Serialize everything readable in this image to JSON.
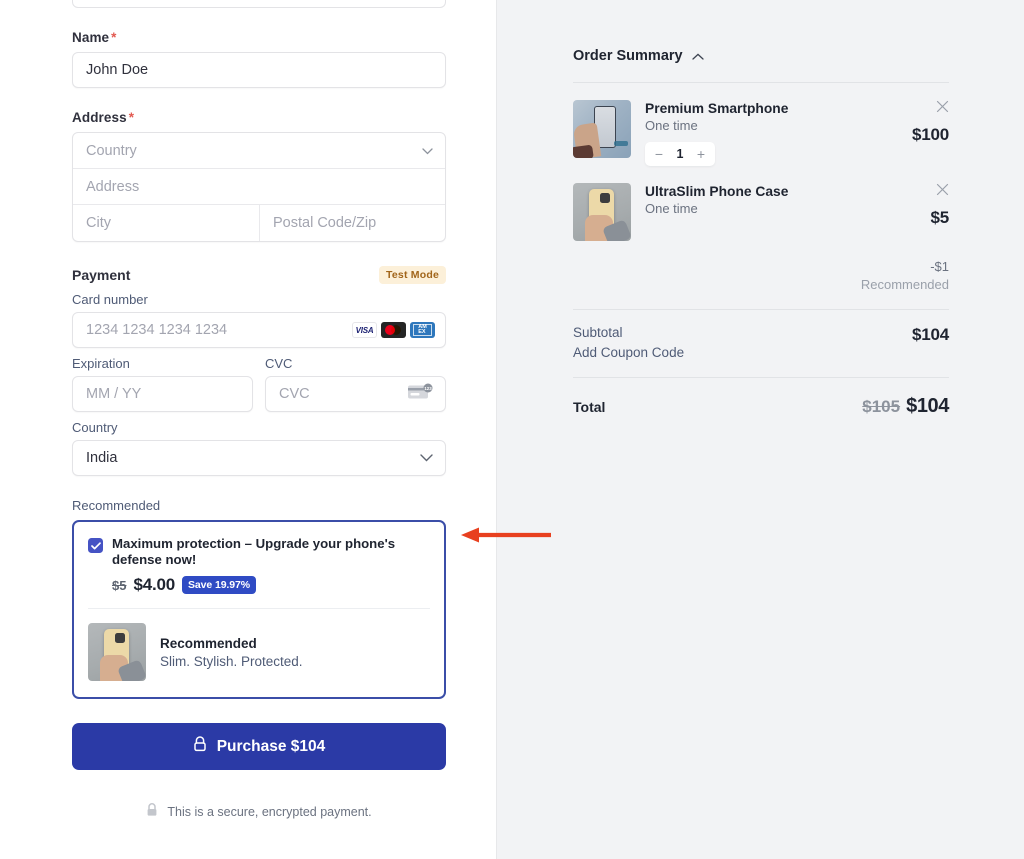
{
  "form": {
    "name": {
      "label": "Name",
      "required_marker": "*",
      "value": "John Doe"
    },
    "address": {
      "label": "Address",
      "required_marker": "*",
      "country_placeholder": "Country",
      "address_placeholder": "Address",
      "city_placeholder": "City",
      "postal_placeholder": "Postal Code/Zip"
    },
    "payment": {
      "title": "Payment",
      "test_mode_badge": "Test Mode",
      "card_number_label": "Card number",
      "card_number_placeholder": "1234 1234 1234 1234",
      "expiration_label": "Expiration",
      "expiration_placeholder": "MM / YY",
      "cvc_label": "CVC",
      "cvc_placeholder": "CVC",
      "country_label": "Country",
      "country_value": "India",
      "brands": [
        "visa-icon",
        "mastercard-icon",
        "amex-icon"
      ]
    },
    "recommended": {
      "section_label": "Recommended",
      "checked": true,
      "headline": "Maximum protection – Upgrade your phone's defense now!",
      "old_price": "$5",
      "new_price": "$4.00",
      "save_badge": "Save 19.97%",
      "item_title": "Recommended",
      "item_desc": "Slim. Stylish. Protected.",
      "thumb_icon": "phone-case-thumbnail"
    },
    "purchase": {
      "lock_icon": "lock-icon",
      "label": "Purchase $104",
      "secure_note": "This is a secure, encrypted payment.",
      "secure_note_icon": "lock-icon"
    }
  },
  "summary": {
    "title": "Order Summary",
    "collapse_icon": "chevron-up-icon",
    "items": [
      {
        "name": "Premium Smartphone",
        "frequency": "One time",
        "price": "$100",
        "quantity": "1",
        "minus_label": "−",
        "plus_label": "+",
        "remove_icon": "close-icon",
        "thumb_icon": "smartphone-in-hand-thumbnail",
        "has_quantity": true
      },
      {
        "name": "UltraSlim Phone Case",
        "frequency": "One time",
        "price": "$5",
        "remove_icon": "close-icon",
        "thumb_icon": "phone-case-thumbnail",
        "has_quantity": false
      }
    ],
    "discount": {
      "amount": "-$1",
      "label": "Recommended"
    },
    "subtotal_label": "Subtotal",
    "subtotal_value": "$104",
    "coupon_label": "Add Coupon Code",
    "total_label": "Total",
    "total_old": "$105",
    "total_new": "$104"
  },
  "annotation": {
    "arrow_icon": "left-arrow-annotation",
    "color": "#e8401f"
  },
  "colors": {
    "accent": "#2b3aa6",
    "panel_bg": "#f2f3f5",
    "required": "#e25950",
    "test_mode_bg": "#fcf0d9",
    "test_mode_fg": "#a1651a",
    "save_badge_bg": "#2f4bc4"
  }
}
